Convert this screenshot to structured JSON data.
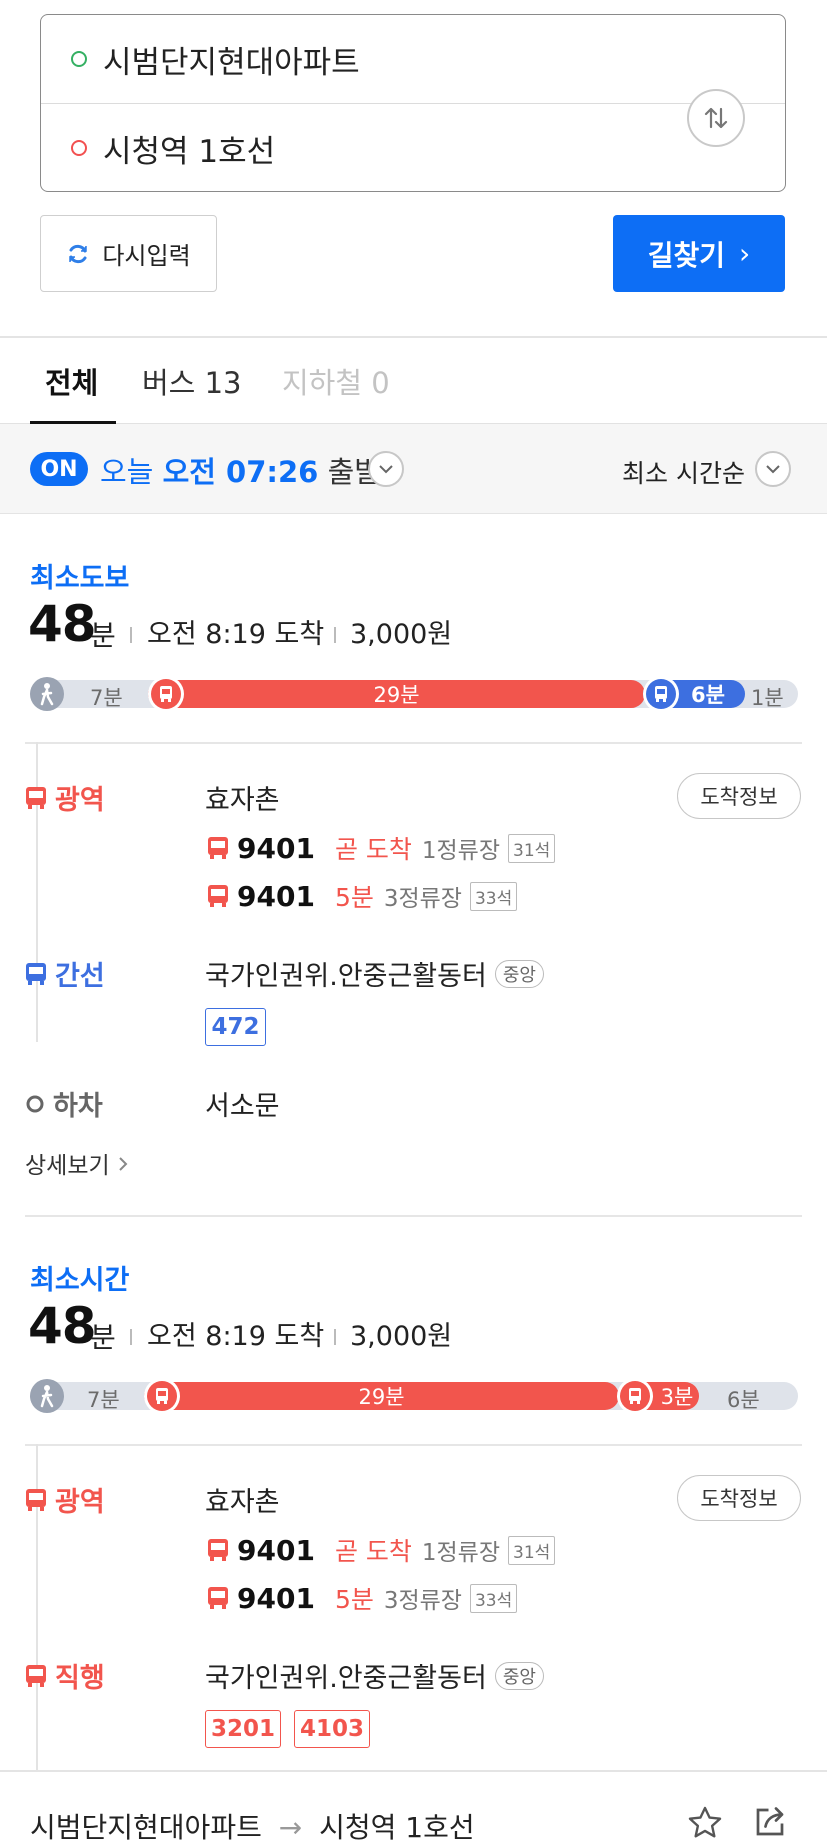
{
  "search": {
    "origin": "시범단지현대아파트",
    "destination": "시청역 1호선",
    "reset_label": "다시입력",
    "find_label": "길찾기",
    "find_chevron": "›"
  },
  "tabs": [
    {
      "label": "전체"
    },
    {
      "label": "버스 13"
    },
    {
      "label": "지하철 0"
    }
  ],
  "time_bar": {
    "badge": "ON",
    "day": "오늘",
    "time": "오전 07:26",
    "depart": "출발",
    "sort": "최소 시간순"
  },
  "routes": [
    {
      "type": "최소도보",
      "duration": "48",
      "unit": "분",
      "arrive": "오전 8:19 도착",
      "fare": "3,000원",
      "segments": {
        "walk1": "7분",
        "bus": "29분",
        "bus2": "6분",
        "walk2": "1분"
      },
      "steps": [
        {
          "type": "광역",
          "stop": "효자촌",
          "arrival_btn": "도착정보",
          "buses": [
            {
              "num": "9401",
              "eta": "곧 도착",
              "stops": "1정류장",
              "seats": "31석"
            },
            {
              "num": "9401",
              "eta": "5분",
              "stops": "3정류장",
              "seats": "33석"
            }
          ]
        },
        {
          "type": "간선",
          "stop": "국가인권위.안중근활동터",
          "badge": "중앙",
          "routes": [
            "472"
          ]
        },
        {
          "type": "하차",
          "stop": "서소문"
        }
      ],
      "detail": "상세보기"
    },
    {
      "type": "최소시간",
      "duration": "48",
      "unit": "분",
      "arrive": "오전 8:19 도착",
      "fare": "3,000원",
      "segments": {
        "walk1": "7분",
        "bus": "29분",
        "bus2": "3분",
        "walk2": "6분"
      },
      "steps": [
        {
          "type": "광역",
          "stop": "효자촌",
          "arrival_btn": "도착정보",
          "buses": [
            {
              "num": "9401",
              "eta": "곧 도착",
              "stops": "1정류장",
              "seats": "31석"
            },
            {
              "num": "9401",
              "eta": "5분",
              "stops": "3정류장",
              "seats": "33석"
            }
          ]
        },
        {
          "type": "직행",
          "stop": "국가인권위.안중근활동터",
          "badge": "중앙",
          "routes": [
            "3201",
            "4103"
          ]
        }
      ]
    }
  ],
  "bottom": {
    "from": "시범단지현대아파트",
    "arrow": "→",
    "to": "시청역 1호선"
  },
  "colors": {
    "primary_blue": "#0d6ef5",
    "bus_red": "#f2554d",
    "trunk_blue": "#3d6fe0",
    "origin_green": "#35b063"
  }
}
